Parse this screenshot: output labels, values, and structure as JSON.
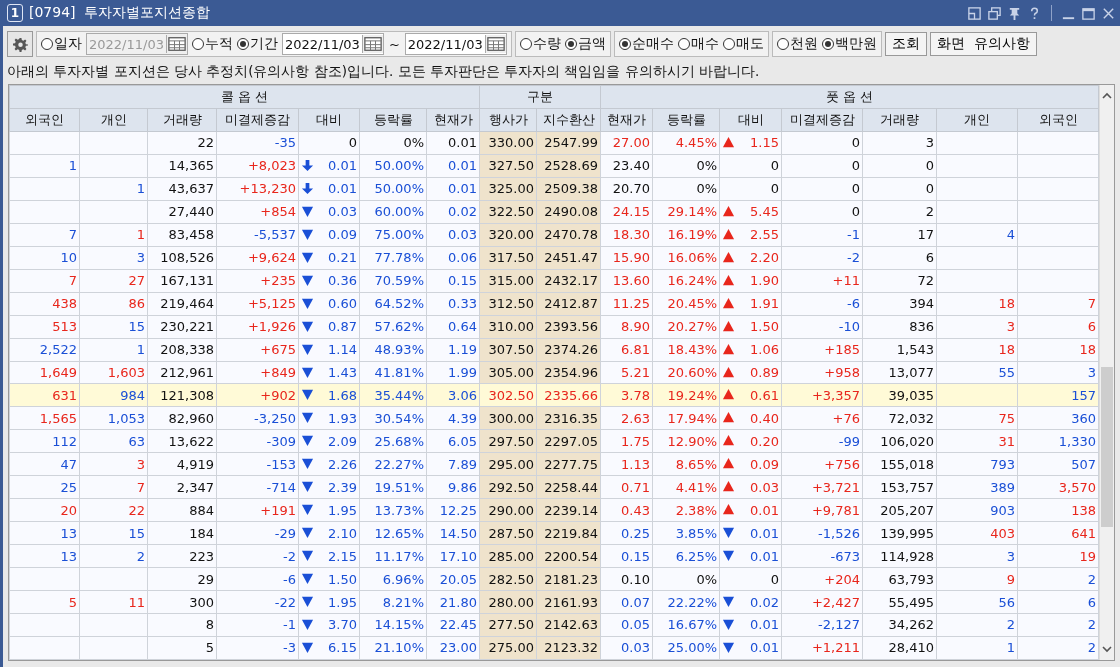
{
  "window": {
    "badge": "1",
    "title": "[0794]  투자자별포지션종합"
  },
  "toolbar": {
    "period": [
      {
        "kind": "radio",
        "label": "일자",
        "selected": false
      },
      {
        "kind": "date",
        "value": "2022/11/03",
        "disabled": true
      },
      {
        "kind": "radio",
        "label": "누적",
        "selected": false
      },
      {
        "kind": "radio",
        "label": "기간",
        "selected": true
      },
      {
        "kind": "date",
        "value": "2022/11/03",
        "disabled": false
      },
      {
        "kind": "text",
        "text": "~"
      },
      {
        "kind": "date",
        "value": "2022/11/03",
        "disabled": false
      }
    ],
    "radio_groups": [
      [
        {
          "label": "수량",
          "selected": false
        },
        {
          "label": "금액",
          "selected": true
        }
      ],
      [
        {
          "label": "순매수",
          "selected": true
        },
        {
          "label": "매수",
          "selected": false
        },
        {
          "label": "매도",
          "selected": false
        }
      ],
      [
        {
          "label": "천원",
          "selected": false
        },
        {
          "label": "백만원",
          "selected": true
        }
      ]
    ],
    "buttons": [
      "조회",
      "화면  유의사항"
    ]
  },
  "notice": "아래의 투자자별 포지션은 당사 추정치(유의사항 참조)입니다.  모든 투자판단은 투자자의 책임임을 유의하시기 바랍니다.",
  "table": {
    "groups": [
      "콜 옵 션",
      "구분",
      "풋 옵 션"
    ],
    "columns": [
      "외국인",
      "개인",
      "거래량",
      "미결제증감",
      "대비",
      "등락률",
      "현재가",
      "행사가",
      "지수환산",
      "현재가",
      "등락률",
      "대비",
      "미결제증감",
      "거래량",
      "개인",
      "외국인"
    ],
    "rows": [
      {
        "highlighted": false,
        "cells": [
          null,
          null,
          {
            "text": "22"
          },
          {
            "text": "-35",
            "color": "#1a4fd6"
          },
          {
            "text": "0"
          },
          {
            "text": "0%"
          },
          {
            "text": "0.01"
          },
          {
            "text": "330.00"
          },
          {
            "text": "2547.99"
          },
          {
            "text": "27.00",
            "color": "#e8261c"
          },
          {
            "text": "4.45%",
            "color": "#e8261c"
          },
          {
            "text": "1.15",
            "color": "#e8261c",
            "kind": "up"
          },
          {
            "text": "0"
          },
          {
            "text": "3"
          },
          null,
          null
        ]
      },
      {
        "highlighted": false,
        "cells": [
          {
            "text": "1",
            "color": "#1a4fd6"
          },
          null,
          {
            "text": "14,365"
          },
          {
            "text": "+8,023",
            "color": "#e8261c"
          },
          {
            "text": "0.01",
            "color": "#1a4fd6",
            "kind": "limit_down"
          },
          {
            "text": "50.00%",
            "color": "#1a4fd6"
          },
          {
            "text": "0.01",
            "color": "#1a4fd6"
          },
          {
            "text": "327.50"
          },
          {
            "text": "2528.69"
          },
          {
            "text": "23.40"
          },
          {
            "text": "0%"
          },
          {
            "text": "0"
          },
          {
            "text": "0"
          },
          {
            "text": "0"
          },
          null,
          null
        ]
      },
      {
        "highlighted": false,
        "cells": [
          null,
          {
            "text": "1",
            "color": "#1a4fd6"
          },
          {
            "text": "43,637"
          },
          {
            "text": "+13,230",
            "color": "#e8261c"
          },
          {
            "text": "0.01",
            "color": "#1a4fd6",
            "kind": "limit_down"
          },
          {
            "text": "50.00%",
            "color": "#1a4fd6"
          },
          {
            "text": "0.01",
            "color": "#1a4fd6"
          },
          {
            "text": "325.00"
          },
          {
            "text": "2509.38"
          },
          {
            "text": "20.70"
          },
          {
            "text": "0%"
          },
          {
            "text": "0"
          },
          {
            "text": "0"
          },
          {
            "text": "0"
          },
          null,
          null
        ]
      },
      {
        "highlighted": false,
        "cells": [
          null,
          null,
          {
            "text": "27,440"
          },
          {
            "text": "+854",
            "color": "#e8261c"
          },
          {
            "text": "0.03",
            "color": "#1a4fd6",
            "kind": "down"
          },
          {
            "text": "60.00%",
            "color": "#1a4fd6"
          },
          {
            "text": "0.02",
            "color": "#1a4fd6"
          },
          {
            "text": "322.50"
          },
          {
            "text": "2490.08"
          },
          {
            "text": "24.15",
            "color": "#e8261c"
          },
          {
            "text": "29.14%",
            "color": "#e8261c"
          },
          {
            "text": "5.45",
            "color": "#e8261c",
            "kind": "up"
          },
          {
            "text": "0"
          },
          {
            "text": "2"
          },
          null,
          null
        ]
      },
      {
        "highlighted": false,
        "cells": [
          {
            "text": "7",
            "color": "#1a4fd6"
          },
          {
            "text": "1",
            "color": "#e8261c"
          },
          {
            "text": "83,458"
          },
          {
            "text": "-5,537",
            "color": "#1a4fd6"
          },
          {
            "text": "0.09",
            "color": "#1a4fd6",
            "kind": "down"
          },
          {
            "text": "75.00%",
            "color": "#1a4fd6"
          },
          {
            "text": "0.03",
            "color": "#1a4fd6"
          },
          {
            "text": "320.00"
          },
          {
            "text": "2470.78"
          },
          {
            "text": "18.30",
            "color": "#e8261c"
          },
          {
            "text": "16.19%",
            "color": "#e8261c"
          },
          {
            "text": "2.55",
            "color": "#e8261c",
            "kind": "up"
          },
          {
            "text": "-1",
            "color": "#1a4fd6"
          },
          {
            "text": "17"
          },
          {
            "text": "4",
            "color": "#1a4fd6"
          },
          null
        ]
      },
      {
        "highlighted": false,
        "cells": [
          {
            "text": "10",
            "color": "#1a4fd6"
          },
          {
            "text": "3",
            "color": "#1a4fd6"
          },
          {
            "text": "108,526"
          },
          {
            "text": "+9,624",
            "color": "#e8261c"
          },
          {
            "text": "0.21",
            "color": "#1a4fd6",
            "kind": "down"
          },
          {
            "text": "77.78%",
            "color": "#1a4fd6"
          },
          {
            "text": "0.06",
            "color": "#1a4fd6"
          },
          {
            "text": "317.50"
          },
          {
            "text": "2451.47"
          },
          {
            "text": "15.90",
            "color": "#e8261c"
          },
          {
            "text": "16.06%",
            "color": "#e8261c"
          },
          {
            "text": "2.20",
            "color": "#e8261c",
            "kind": "up"
          },
          {
            "text": "-2",
            "color": "#1a4fd6"
          },
          {
            "text": "6"
          },
          null,
          null
        ]
      },
      {
        "highlighted": false,
        "cells": [
          {
            "text": "7",
            "color": "#e8261c"
          },
          {
            "text": "27",
            "color": "#e8261c"
          },
          {
            "text": "167,131"
          },
          {
            "text": "+235",
            "color": "#e8261c"
          },
          {
            "text": "0.36",
            "color": "#1a4fd6",
            "kind": "down"
          },
          {
            "text": "70.59%",
            "color": "#1a4fd6"
          },
          {
            "text": "0.15",
            "color": "#1a4fd6"
          },
          {
            "text": "315.00"
          },
          {
            "text": "2432.17"
          },
          {
            "text": "13.60",
            "color": "#e8261c"
          },
          {
            "text": "16.24%",
            "color": "#e8261c"
          },
          {
            "text": "1.90",
            "color": "#e8261c",
            "kind": "up"
          },
          {
            "text": "+11",
            "color": "#e8261c"
          },
          {
            "text": "72"
          },
          null,
          null
        ]
      },
      {
        "highlighted": false,
        "cells": [
          {
            "text": "438",
            "color": "#e8261c"
          },
          {
            "text": "86",
            "color": "#e8261c"
          },
          {
            "text": "219,464"
          },
          {
            "text": "+5,125",
            "color": "#e8261c"
          },
          {
            "text": "0.60",
            "color": "#1a4fd6",
            "kind": "down"
          },
          {
            "text": "64.52%",
            "color": "#1a4fd6"
          },
          {
            "text": "0.33",
            "color": "#1a4fd6"
          },
          {
            "text": "312.50"
          },
          {
            "text": "2412.87"
          },
          {
            "text": "11.25",
            "color": "#e8261c"
          },
          {
            "text": "20.45%",
            "color": "#e8261c"
          },
          {
            "text": "1.91",
            "color": "#e8261c",
            "kind": "up"
          },
          {
            "text": "-6",
            "color": "#1a4fd6"
          },
          {
            "text": "394"
          },
          {
            "text": "18",
            "color": "#e8261c"
          },
          {
            "text": "7",
            "color": "#e8261c"
          }
        ]
      },
      {
        "highlighted": false,
        "cells": [
          {
            "text": "513",
            "color": "#e8261c"
          },
          {
            "text": "15",
            "color": "#1a4fd6"
          },
          {
            "text": "230,221"
          },
          {
            "text": "+1,926",
            "color": "#e8261c"
          },
          {
            "text": "0.87",
            "color": "#1a4fd6",
            "kind": "down"
          },
          {
            "text": "57.62%",
            "color": "#1a4fd6"
          },
          {
            "text": "0.64",
            "color": "#1a4fd6"
          },
          {
            "text": "310.00"
          },
          {
            "text": "2393.56"
          },
          {
            "text": "8.90",
            "color": "#e8261c"
          },
          {
            "text": "20.27%",
            "color": "#e8261c"
          },
          {
            "text": "1.50",
            "color": "#e8261c",
            "kind": "up"
          },
          {
            "text": "-10",
            "color": "#1a4fd6"
          },
          {
            "text": "836"
          },
          {
            "text": "3",
            "color": "#e8261c"
          },
          {
            "text": "6",
            "color": "#e8261c"
          }
        ]
      },
      {
        "highlighted": false,
        "cells": [
          {
            "text": "2,522",
            "color": "#1a4fd6"
          },
          {
            "text": "1",
            "color": "#1a4fd6"
          },
          {
            "text": "208,338"
          },
          {
            "text": "+675",
            "color": "#e8261c"
          },
          {
            "text": "1.14",
            "color": "#1a4fd6",
            "kind": "down"
          },
          {
            "text": "48.93%",
            "color": "#1a4fd6"
          },
          {
            "text": "1.19",
            "color": "#1a4fd6"
          },
          {
            "text": "307.50"
          },
          {
            "text": "2374.26"
          },
          {
            "text": "6.81",
            "color": "#e8261c"
          },
          {
            "text": "18.43%",
            "color": "#e8261c"
          },
          {
            "text": "1.06",
            "color": "#e8261c",
            "kind": "up"
          },
          {
            "text": "+185",
            "color": "#e8261c"
          },
          {
            "text": "1,543"
          },
          {
            "text": "18",
            "color": "#e8261c"
          },
          {
            "text": "18",
            "color": "#e8261c"
          }
        ]
      },
      {
        "highlighted": false,
        "cells": [
          {
            "text": "1,649",
            "color": "#e8261c"
          },
          {
            "text": "1,603",
            "color": "#e8261c"
          },
          {
            "text": "212,961"
          },
          {
            "text": "+849",
            "color": "#e8261c"
          },
          {
            "text": "1.43",
            "color": "#1a4fd6",
            "kind": "down"
          },
          {
            "text": "41.81%",
            "color": "#1a4fd6"
          },
          {
            "text": "1.99",
            "color": "#1a4fd6"
          },
          {
            "text": "305.00"
          },
          {
            "text": "2354.96"
          },
          {
            "text": "5.21",
            "color": "#e8261c"
          },
          {
            "text": "20.60%",
            "color": "#e8261c"
          },
          {
            "text": "0.89",
            "color": "#e8261c",
            "kind": "up"
          },
          {
            "text": "+958",
            "color": "#e8261c"
          },
          {
            "text": "13,077"
          },
          {
            "text": "55",
            "color": "#1a4fd6"
          },
          {
            "text": "3",
            "color": "#1a4fd6"
          }
        ]
      },
      {
        "highlighted": true,
        "cells": [
          {
            "text": "631",
            "color": "#e8261c"
          },
          {
            "text": "984",
            "color": "#1a4fd6"
          },
          {
            "text": "121,308"
          },
          {
            "text": "+902",
            "color": "#e8261c"
          },
          {
            "text": "1.68",
            "color": "#1a4fd6",
            "kind": "down"
          },
          {
            "text": "35.44%",
            "color": "#1a4fd6"
          },
          {
            "text": "3.06",
            "color": "#1a4fd6"
          },
          {
            "text": "302.50",
            "color": "#e8261c"
          },
          {
            "text": "2335.66",
            "color": "#e8261c"
          },
          {
            "text": "3.78",
            "color": "#e8261c"
          },
          {
            "text": "19.24%",
            "color": "#e8261c"
          },
          {
            "text": "0.61",
            "color": "#e8261c",
            "kind": "up"
          },
          {
            "text": "+3,357",
            "color": "#e8261c"
          },
          {
            "text": "39,035"
          },
          null,
          {
            "text": "157",
            "color": "#1a4fd6"
          }
        ]
      },
      {
        "highlighted": false,
        "cells": [
          {
            "text": "1,565",
            "color": "#e8261c"
          },
          {
            "text": "1,053",
            "color": "#1a4fd6"
          },
          {
            "text": "82,960"
          },
          {
            "text": "-3,250",
            "color": "#1a4fd6"
          },
          {
            "text": "1.93",
            "color": "#1a4fd6",
            "kind": "down"
          },
          {
            "text": "30.54%",
            "color": "#1a4fd6"
          },
          {
            "text": "4.39",
            "color": "#1a4fd6"
          },
          {
            "text": "300.00"
          },
          {
            "text": "2316.35"
          },
          {
            "text": "2.63",
            "color": "#e8261c"
          },
          {
            "text": "17.94%",
            "color": "#e8261c"
          },
          {
            "text": "0.40",
            "color": "#e8261c",
            "kind": "up"
          },
          {
            "text": "+76",
            "color": "#e8261c"
          },
          {
            "text": "72,032"
          },
          {
            "text": "75",
            "color": "#e8261c"
          },
          {
            "text": "360",
            "color": "#1a4fd6"
          }
        ]
      },
      {
        "highlighted": false,
        "cells": [
          {
            "text": "112",
            "color": "#1a4fd6"
          },
          {
            "text": "63",
            "color": "#1a4fd6"
          },
          {
            "text": "13,622"
          },
          {
            "text": "-309",
            "color": "#1a4fd6"
          },
          {
            "text": "2.09",
            "color": "#1a4fd6",
            "kind": "down"
          },
          {
            "text": "25.68%",
            "color": "#1a4fd6"
          },
          {
            "text": "6.05",
            "color": "#1a4fd6"
          },
          {
            "text": "297.50"
          },
          {
            "text": "2297.05"
          },
          {
            "text": "1.75",
            "color": "#e8261c"
          },
          {
            "text": "12.90%",
            "color": "#e8261c"
          },
          {
            "text": "0.20",
            "color": "#e8261c",
            "kind": "up"
          },
          {
            "text": "-99",
            "color": "#1a4fd6"
          },
          {
            "text": "106,020"
          },
          {
            "text": "31",
            "color": "#e8261c"
          },
          {
            "text": "1,330",
            "color": "#1a4fd6"
          }
        ]
      },
      {
        "highlighted": false,
        "cells": [
          {
            "text": "47",
            "color": "#1a4fd6"
          },
          {
            "text": "3",
            "color": "#e8261c"
          },
          {
            "text": "4,919"
          },
          {
            "text": "-153",
            "color": "#1a4fd6"
          },
          {
            "text": "2.26",
            "color": "#1a4fd6",
            "kind": "down"
          },
          {
            "text": "22.27%",
            "color": "#1a4fd6"
          },
          {
            "text": "7.89",
            "color": "#1a4fd6"
          },
          {
            "text": "295.00"
          },
          {
            "text": "2277.75"
          },
          {
            "text": "1.13",
            "color": "#e8261c"
          },
          {
            "text": "8.65%",
            "color": "#e8261c"
          },
          {
            "text": "0.09",
            "color": "#e8261c",
            "kind": "up"
          },
          {
            "text": "+756",
            "color": "#e8261c"
          },
          {
            "text": "155,018"
          },
          {
            "text": "793",
            "color": "#1a4fd6"
          },
          {
            "text": "507",
            "color": "#1a4fd6"
          }
        ]
      },
      {
        "highlighted": false,
        "cells": [
          {
            "text": "25",
            "color": "#1a4fd6"
          },
          {
            "text": "7",
            "color": "#e8261c"
          },
          {
            "text": "2,347"
          },
          {
            "text": "-714",
            "color": "#1a4fd6"
          },
          {
            "text": "2.39",
            "color": "#1a4fd6",
            "kind": "down"
          },
          {
            "text": "19.51%",
            "color": "#1a4fd6"
          },
          {
            "text": "9.86",
            "color": "#1a4fd6"
          },
          {
            "text": "292.50"
          },
          {
            "text": "2258.44"
          },
          {
            "text": "0.71",
            "color": "#e8261c"
          },
          {
            "text": "4.41%",
            "color": "#e8261c"
          },
          {
            "text": "0.03",
            "color": "#e8261c",
            "kind": "up"
          },
          {
            "text": "+3,721",
            "color": "#e8261c"
          },
          {
            "text": "153,757"
          },
          {
            "text": "389",
            "color": "#1a4fd6"
          },
          {
            "text": "3,570",
            "color": "#e8261c"
          }
        ]
      },
      {
        "highlighted": false,
        "cells": [
          {
            "text": "20",
            "color": "#e8261c"
          },
          {
            "text": "22",
            "color": "#e8261c"
          },
          {
            "text": "884"
          },
          {
            "text": "+191",
            "color": "#e8261c"
          },
          {
            "text": "1.95",
            "color": "#1a4fd6",
            "kind": "down"
          },
          {
            "text": "13.73%",
            "color": "#1a4fd6"
          },
          {
            "text": "12.25",
            "color": "#1a4fd6"
          },
          {
            "text": "290.00"
          },
          {
            "text": "2239.14"
          },
          {
            "text": "0.43",
            "color": "#e8261c"
          },
          {
            "text": "2.38%",
            "color": "#e8261c"
          },
          {
            "text": "0.01",
            "color": "#e8261c",
            "kind": "up"
          },
          {
            "text": "+9,781",
            "color": "#e8261c"
          },
          {
            "text": "205,207"
          },
          {
            "text": "903",
            "color": "#1a4fd6"
          },
          {
            "text": "138",
            "color": "#e8261c"
          }
        ]
      },
      {
        "highlighted": false,
        "cells": [
          {
            "text": "13",
            "color": "#1a4fd6"
          },
          {
            "text": "15",
            "color": "#1a4fd6"
          },
          {
            "text": "184"
          },
          {
            "text": "-29",
            "color": "#1a4fd6"
          },
          {
            "text": "2.10",
            "color": "#1a4fd6",
            "kind": "down"
          },
          {
            "text": "12.65%",
            "color": "#1a4fd6"
          },
          {
            "text": "14.50",
            "color": "#1a4fd6"
          },
          {
            "text": "287.50"
          },
          {
            "text": "2219.84"
          },
          {
            "text": "0.25",
            "color": "#1a4fd6"
          },
          {
            "text": "3.85%",
            "color": "#1a4fd6"
          },
          {
            "text": "0.01",
            "color": "#1a4fd6",
            "kind": "down"
          },
          {
            "text": "-1,526",
            "color": "#1a4fd6"
          },
          {
            "text": "139,995"
          },
          {
            "text": "403",
            "color": "#e8261c"
          },
          {
            "text": "641",
            "color": "#e8261c"
          }
        ]
      },
      {
        "highlighted": false,
        "cells": [
          {
            "text": "13",
            "color": "#1a4fd6"
          },
          {
            "text": "2",
            "color": "#1a4fd6"
          },
          {
            "text": "223"
          },
          {
            "text": "-2",
            "color": "#1a4fd6"
          },
          {
            "text": "2.15",
            "color": "#1a4fd6",
            "kind": "down"
          },
          {
            "text": "11.17%",
            "color": "#1a4fd6"
          },
          {
            "text": "17.10",
            "color": "#1a4fd6"
          },
          {
            "text": "285.00"
          },
          {
            "text": "2200.54"
          },
          {
            "text": "0.15",
            "color": "#1a4fd6"
          },
          {
            "text": "6.25%",
            "color": "#1a4fd6"
          },
          {
            "text": "0.01",
            "color": "#1a4fd6",
            "kind": "down"
          },
          {
            "text": "-673",
            "color": "#1a4fd6"
          },
          {
            "text": "114,928"
          },
          {
            "text": "3",
            "color": "#1a4fd6"
          },
          {
            "text": "19",
            "color": "#e8261c"
          }
        ]
      },
      {
        "highlighted": false,
        "cells": [
          null,
          null,
          {
            "text": "29"
          },
          {
            "text": "-6",
            "color": "#1a4fd6"
          },
          {
            "text": "1.50",
            "color": "#1a4fd6",
            "kind": "down"
          },
          {
            "text": "6.96%",
            "color": "#1a4fd6"
          },
          {
            "text": "20.05",
            "color": "#1a4fd6"
          },
          {
            "text": "282.50"
          },
          {
            "text": "2181.23"
          },
          {
            "text": "0.10"
          },
          {
            "text": "0%"
          },
          {
            "text": "0"
          },
          {
            "text": "+204",
            "color": "#e8261c"
          },
          {
            "text": "63,793"
          },
          {
            "text": "9",
            "color": "#e8261c"
          },
          {
            "text": "2",
            "color": "#1a4fd6"
          }
        ]
      },
      {
        "highlighted": false,
        "cells": [
          {
            "text": "5",
            "color": "#e8261c"
          },
          {
            "text": "11",
            "color": "#e8261c"
          },
          {
            "text": "300"
          },
          {
            "text": "-22",
            "color": "#1a4fd6"
          },
          {
            "text": "1.95",
            "color": "#1a4fd6",
            "kind": "down"
          },
          {
            "text": "8.21%",
            "color": "#1a4fd6"
          },
          {
            "text": "21.80",
            "color": "#1a4fd6"
          },
          {
            "text": "280.00"
          },
          {
            "text": "2161.93"
          },
          {
            "text": "0.07",
            "color": "#1a4fd6"
          },
          {
            "text": "22.22%",
            "color": "#1a4fd6"
          },
          {
            "text": "0.02",
            "color": "#1a4fd6",
            "kind": "down"
          },
          {
            "text": "+2,427",
            "color": "#e8261c"
          },
          {
            "text": "55,495"
          },
          {
            "text": "56",
            "color": "#1a4fd6"
          },
          {
            "text": "6",
            "color": "#1a4fd6"
          }
        ]
      },
      {
        "highlighted": false,
        "cells": [
          null,
          null,
          {
            "text": "8"
          },
          {
            "text": "-1",
            "color": "#1a4fd6"
          },
          {
            "text": "3.70",
            "color": "#1a4fd6",
            "kind": "down"
          },
          {
            "text": "14.15%",
            "color": "#1a4fd6"
          },
          {
            "text": "22.45",
            "color": "#1a4fd6"
          },
          {
            "text": "277.50"
          },
          {
            "text": "2142.63"
          },
          {
            "text": "0.05",
            "color": "#1a4fd6"
          },
          {
            "text": "16.67%",
            "color": "#1a4fd6"
          },
          {
            "text": "0.01",
            "color": "#1a4fd6",
            "kind": "down"
          },
          {
            "text": "-2,127",
            "color": "#1a4fd6"
          },
          {
            "text": "34,262"
          },
          {
            "text": "2",
            "color": "#1a4fd6"
          },
          {
            "text": "2",
            "color": "#1a4fd6"
          }
        ]
      },
      {
        "highlighted": false,
        "cells": [
          null,
          null,
          {
            "text": "5"
          },
          {
            "text": "-3",
            "color": "#1a4fd6"
          },
          {
            "text": "6.15",
            "color": "#1a4fd6",
            "kind": "down"
          },
          {
            "text": "21.10%",
            "color": "#1a4fd6"
          },
          {
            "text": "23.00",
            "color": "#1a4fd6"
          },
          {
            "text": "275.00"
          },
          {
            "text": "2123.32"
          },
          {
            "text": "0.03",
            "color": "#1a4fd6"
          },
          {
            "text": "25.00%",
            "color": "#1a4fd6"
          },
          {
            "text": "0.01",
            "color": "#1a4fd6",
            "kind": "down"
          },
          {
            "text": "+1,211",
            "color": "#e8261c"
          },
          {
            "text": "28,410"
          },
          {
            "text": "1",
            "color": "#1a4fd6"
          },
          {
            "text": "2",
            "color": "#1a4fd6"
          }
        ]
      }
    ]
  }
}
